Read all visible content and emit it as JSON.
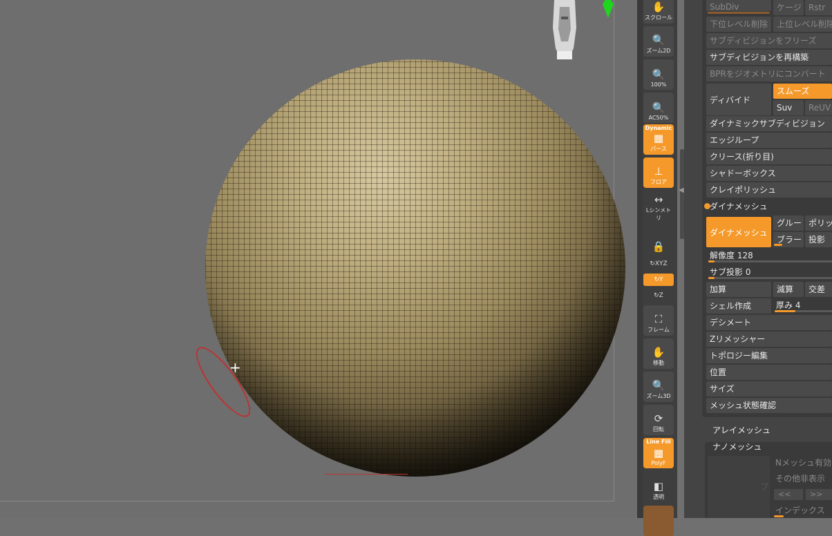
{
  "shelf": {
    "scroll": "スクロール",
    "zoom2d": "ズーム2D",
    "zoom100": "100%",
    "ac50": "AC50%",
    "dynamic": "Dynamic",
    "perspective": "パース",
    "floor": "フロア",
    "symmetry": "Lシンメトリ",
    "xyz": "XYZ",
    "frame": "フレーム",
    "move": "移動",
    "zoom3d": "ズーム3D",
    "rotate": "回転",
    "linefill": "Line Fill",
    "polyf": "PolyF",
    "transparent": "透明"
  },
  "subdiv": {
    "subdiv": "SubDiv",
    "cage": "ケージ",
    "rstr": "Rstr",
    "del_lower": "下位レベル削除",
    "del_higher": "上位レベル削除",
    "freeze": "サブディビジョンをフリーズ",
    "reconstruct": "サブディビジョンを再構築",
    "bpr_convert": "BPRをジオメトリにコンバート",
    "divide": "ディバイド",
    "smooth": "スムーズ",
    "suv": "Suv",
    "reuv": "ReUV"
  },
  "menu": {
    "dynamic_subdiv": "ダイナミックサブディビジョン",
    "edge_loop": "エッジループ",
    "crease": "クリース(折り目)",
    "shadowbox": "シャドーボックス",
    "claypolish": "クレイポリッシュ",
    "dynamesh_section": "ダイナメッシュ",
    "decimate": "デシメート",
    "zremesher": "Zリメッシャー",
    "topology": "トポロジー編集",
    "position": "位置",
    "size": "サイズ",
    "mesh_check": "メッシュ状態確認"
  },
  "dynamesh": {
    "button": "ダイナメッシュ",
    "groups": "グルー ",
    "polish": "ポリッ",
    "blur": "ブラー",
    "project": "投影",
    "resolution_label": "解像度 128",
    "resolution_value": 0.05,
    "subproject_label": "サブ投影 0",
    "subproject_value": 0.05,
    "add": "加算",
    "subtract": "減算",
    "intersect": "交差",
    "create_shell": "シェル作成",
    "thickness_label": "厚み 4",
    "thickness_value": 0.35
  },
  "array_mesh": "アレイメッシュ",
  "nano": {
    "title": "ナノメッシュ",
    "enable": "Nメッシュ有効",
    "others": "その他非表示",
    "prev": "<<",
    "next": ">>",
    "index": "インデックス",
    "preview": "プ"
  },
  "colors": {
    "accent": "#f59a2a",
    "background": "#6e6e6e",
    "panel": "#444444",
    "brush": "#c03030"
  }
}
